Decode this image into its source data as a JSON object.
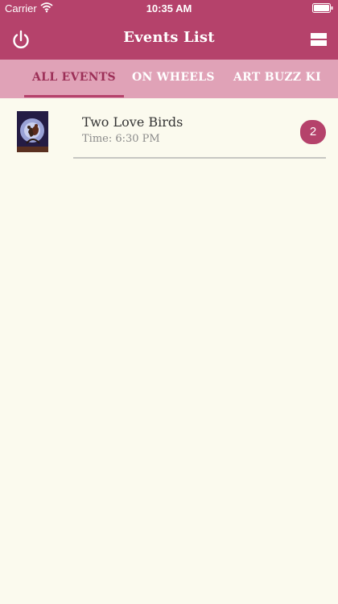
{
  "status_bar": {
    "carrier": "Carrier",
    "time": "10:35 AM"
  },
  "header": {
    "title": "Events List"
  },
  "tabs": [
    {
      "label": "ALL EVENTS",
      "active": true
    },
    {
      "label": "ON WHEELS",
      "active": false
    },
    {
      "label": "ART BUZZ KI"
    }
  ],
  "events": [
    {
      "name": "Two Love Birds",
      "time": "Time: 6:30 PM",
      "count": "2"
    }
  ],
  "colors": {
    "primary": "#b5426b",
    "tab_bar": "#e0a2b7",
    "background": "#fbfaee"
  },
  "icons": {
    "power": "power-icon",
    "menu": "menu-icon",
    "wifi": "wifi-icon",
    "battery": "battery-icon"
  }
}
